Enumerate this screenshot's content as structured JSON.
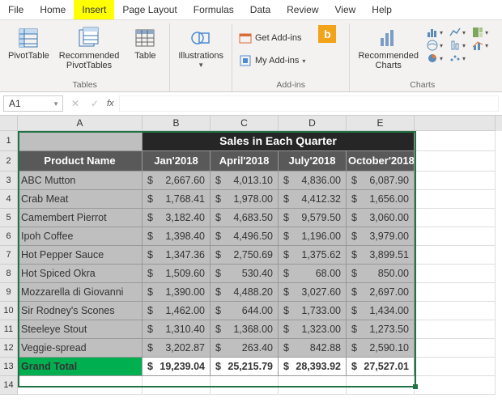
{
  "menu": {
    "items": [
      "File",
      "Home",
      "Insert",
      "Page Layout",
      "Formulas",
      "Data",
      "Review",
      "View",
      "Help"
    ],
    "active_index": 2
  },
  "ribbon": {
    "tables": {
      "label": "Tables",
      "pivot_table": "PivotTable",
      "recommended_pivot": "Recommended\nPivotTables",
      "table": "Table"
    },
    "illustrations": {
      "label": "",
      "btn": "Illustrations"
    },
    "addins": {
      "label": "Add-ins",
      "get": "Get Add-ins",
      "my": "My Add-ins"
    },
    "charts": {
      "label": "Charts",
      "recommended": "Recommended\nCharts"
    }
  },
  "namebox": "A1",
  "chart_data": {
    "type": "table",
    "title": "Sales in Each Quarter",
    "columns": [
      "Product Name",
      "Jan'2018",
      "April'2018",
      "July'2018",
      "October'2018"
    ],
    "rows": [
      {
        "name": "ABC Mutton",
        "jan": "2,667.60",
        "apr": "4,013.10",
        "jul": "4,836.00",
        "oct": "6,087.90"
      },
      {
        "name": "Crab Meat",
        "jan": "1,768.41",
        "apr": "1,978.00",
        "jul": "4,412.32",
        "oct": "1,656.00"
      },
      {
        "name": "Camembert Pierrot",
        "jan": "3,182.40",
        "apr": "4,683.50",
        "jul": "9,579.50",
        "oct": "3,060.00"
      },
      {
        "name": "Ipoh Coffee",
        "jan": "1,398.40",
        "apr": "4,496.50",
        "jul": "1,196.00",
        "oct": "3,979.00"
      },
      {
        "name": "Hot Pepper Sauce",
        "jan": "1,347.36",
        "apr": "2,750.69",
        "jul": "1,375.62",
        "oct": "3,899.51"
      },
      {
        "name": " Hot Spiced Okra",
        "jan": "1,509.60",
        "apr": "530.40",
        "jul": "68.00",
        "oct": "850.00"
      },
      {
        "name": "Mozzarella di Giovanni",
        "jan": "1,390.00",
        "apr": "4,488.20",
        "jul": "3,027.60",
        "oct": "2,697.00"
      },
      {
        "name": "Sir Rodney's Scones",
        "jan": "1,462.00",
        "apr": "644.00",
        "jul": "1,733.00",
        "oct": "1,434.00"
      },
      {
        "name": "Steeleye Stout",
        "jan": "1,310.40",
        "apr": "1,368.00",
        "jul": "1,323.00",
        "oct": "1,273.50"
      },
      {
        "name": "Veggie-spread",
        "jan": "3,202.87",
        "apr": "263.40",
        "jul": "842.88",
        "oct": "2,590.10"
      }
    ],
    "grand_total": {
      "label": "Grand Total",
      "jan": "19,239.04",
      "apr": "25,215.79",
      "jul": "28,393.92",
      "oct": "27,527.01"
    }
  },
  "col_letters": [
    "A",
    "B",
    "C",
    "D",
    "E"
  ],
  "row_nums": [
    "1",
    "2",
    "3",
    "4",
    "5",
    "6",
    "7",
    "8",
    "9",
    "10",
    "11",
    "12",
    "13",
    "14"
  ],
  "currency": "$"
}
